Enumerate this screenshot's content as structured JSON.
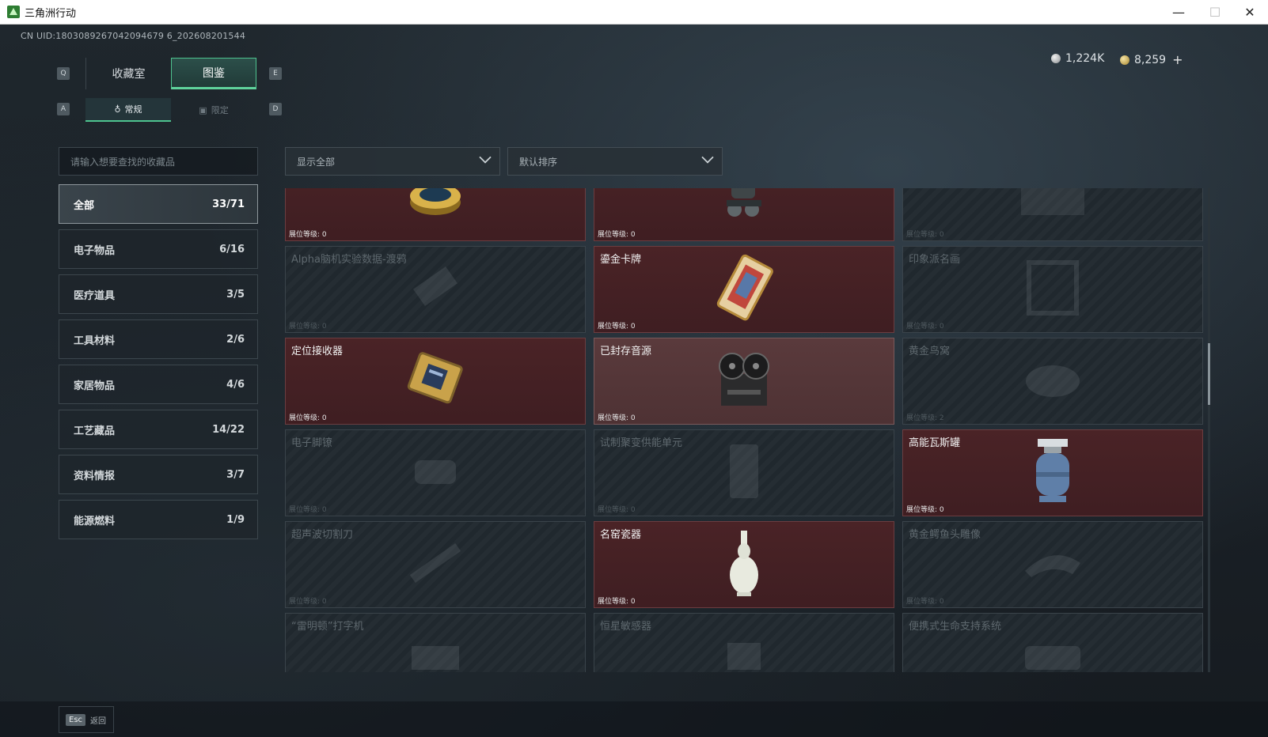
{
  "window": {
    "title": "三角洲行动",
    "min": "—",
    "max": "☐",
    "close": "✕"
  },
  "uid": "CN UID:1803089267042094679 6_202608201544",
  "currency": {
    "silver": "1,224K",
    "gold": "8,259",
    "add": "+"
  },
  "keyhints": {
    "q": "Q",
    "e": "E",
    "a": "A",
    "d": "D"
  },
  "tabs": {
    "collection_room": "收藏室",
    "catalog": "图鉴"
  },
  "subtabs": {
    "regular": "常规",
    "limited": "限定"
  },
  "search": {
    "placeholder": "请输入想要查找的收藏品"
  },
  "filters": {
    "show_all": "显示全部",
    "sort": "默认排序"
  },
  "categories": [
    {
      "label": "全部",
      "count": "33/71"
    },
    {
      "label": "电子物品",
      "count": "6/16"
    },
    {
      "label": "医疗道具",
      "count": "3/5"
    },
    {
      "label": "工具材料",
      "count": "2/6"
    },
    {
      "label": "家居物品",
      "count": "4/6"
    },
    {
      "label": "工艺藏品",
      "count": "14/22"
    },
    {
      "label": "资料情报",
      "count": "3/7"
    },
    {
      "label": "能源燃料",
      "count": "1/9"
    }
  ],
  "level_prefix": "展位等级:",
  "items": [
    {
      "name": "",
      "level": "展位等级: 0",
      "owned": true,
      "icon": "caviar-tin-icon"
    },
    {
      "name": "",
      "level": "展位等级: 0",
      "owned": true,
      "icon": "robot-icon"
    },
    {
      "name": "",
      "level": "展位等级: 0",
      "owned": false,
      "icon": "box-icon"
    },
    {
      "name": "Alpha脑机实验数据-渡鸦",
      "level": "展位等级: 0",
      "owned": false,
      "icon": "data-drive-icon"
    },
    {
      "name": "鎏金卡牌",
      "level": "展位等级: 0",
      "owned": true,
      "icon": "gold-card-icon"
    },
    {
      "name": "印象派名画",
      "level": "展位等级: 0",
      "owned": false,
      "icon": "painting-icon"
    },
    {
      "name": "定位接收器",
      "level": "展位等级: 0",
      "owned": true,
      "icon": "receiver-icon"
    },
    {
      "name": "已封存音源",
      "level": "展位等级: 0",
      "owned": true,
      "icon": "tape-recorder-icon",
      "highlight": true
    },
    {
      "name": "黄金鸟窝",
      "level": "展位等级: 2",
      "owned": false,
      "icon": "bird-nest-icon"
    },
    {
      "name": "电子脚镣",
      "level": "展位等级: 0",
      "owned": false,
      "icon": "ankle-monitor-icon"
    },
    {
      "name": "试制聚变供能单元",
      "level": "展位等级: 0",
      "owned": false,
      "icon": "fusion-cell-icon"
    },
    {
      "name": "高能瓦斯罐",
      "level": "展位等级: 0",
      "owned": true,
      "icon": "gas-canister-icon"
    },
    {
      "name": "超声波切割刀",
      "level": "展位等级: 0",
      "owned": false,
      "icon": "ultrasonic-cutter-icon"
    },
    {
      "name": "名窑瓷器",
      "level": "展位等级: 0",
      "owned": true,
      "icon": "porcelain-vase-icon"
    },
    {
      "name": "黄金鳄鱼头雕像",
      "level": "展位等级: 0",
      "owned": false,
      "icon": "croc-statue-icon"
    },
    {
      "name": "“雷明顿”打字机",
      "level": "",
      "owned": false,
      "icon": "typewriter-icon"
    },
    {
      "name": "恒星敏感器",
      "level": "",
      "owned": false,
      "icon": "star-sensor-icon"
    },
    {
      "name": "便携式生命支持系统",
      "level": "",
      "owned": false,
      "icon": "life-support-icon"
    }
  ],
  "footer": {
    "esc_key": "Esc",
    "back": "返回"
  },
  "colors": {
    "accent": "#4ec38f",
    "owned_bg": "#4a2326",
    "locked_bg": "#20282e"
  }
}
